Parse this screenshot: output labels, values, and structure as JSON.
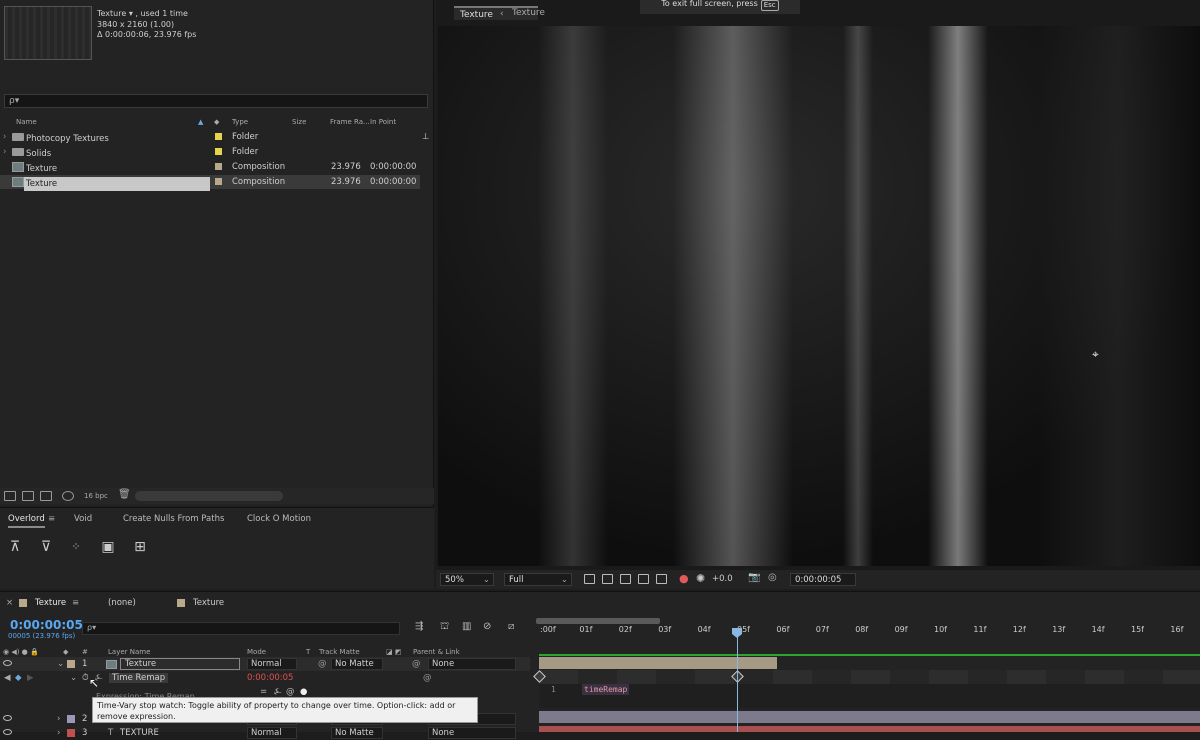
{
  "project": {
    "comp_name": "Texture ▾ , used 1 time",
    "comp_size": "3840 x 2160 (1.00)",
    "comp_duration": "Δ 0:00:00:06, 23.976 fps",
    "search_placeholder": "ρ▾",
    "columns": {
      "name": "Name",
      "type": "Type",
      "size": "Size",
      "frame_rate": "Frame Ra...",
      "in_point": "In Point"
    },
    "rows": [
      {
        "name": "Photocopy Textures",
        "type": "Folder",
        "frame_rate": "",
        "in_point": "",
        "label_color": "#e6d54a"
      },
      {
        "name": "Solids",
        "type": "Folder",
        "frame_rate": "",
        "in_point": "",
        "label_color": "#e6d54a"
      },
      {
        "name": "Texture",
        "type": "Composition",
        "frame_rate": "23.976",
        "in_point": "0:00:00:00",
        "label_color": "#b9a98a"
      },
      {
        "name": "Texture",
        "type": "Composition",
        "frame_rate": "23.976",
        "in_point": "0:00:00:00",
        "label_color": "#b9a98a"
      }
    ],
    "bpc": "16 bpc"
  },
  "overlord": {
    "tabs": [
      "Overlord",
      "Void",
      "Create Nulls From Paths",
      "Clock O Motion"
    ]
  },
  "viewer": {
    "tab_active": "Texture",
    "tab_breadcrumb": "Texture",
    "fullscreen_note": "To exit full screen, press",
    "esc_key": "Esc",
    "zoom": "50%",
    "resolution": "Full",
    "exposure": "+0.0",
    "timecode": "0:00:00:05"
  },
  "timeline": {
    "tab_comp": "Texture",
    "tab_none": "(none)",
    "tab_comp2": "Texture",
    "current_time": "0:00:00:05",
    "frames_label": "00005 (23.976 fps)",
    "search_placeholder": "ρ▾",
    "headers": {
      "num": "#",
      "layer_name": "Layer Name",
      "mode": "Mode",
      "t": "T",
      "track_matte": "Track Matte",
      "parent": "Parent & Link"
    },
    "layers": [
      {
        "num": "1",
        "name": "Texture",
        "mode": "Normal",
        "matte": "No Matte",
        "parent": "None"
      },
      {
        "num": "2",
        "name": "",
        "mode": "Normal",
        "matte": "No Matte",
        "parent": "None"
      },
      {
        "num": "3",
        "name": "TEXTURE",
        "mode": "Normal",
        "matte": "No Matte",
        "parent": "None"
      }
    ],
    "property_name": "Time Remap",
    "property_value": "0:00:00:05",
    "expression_label": "Expression: Time Remap",
    "expression_line": "1",
    "expression_code": "timeRemap",
    "tooltip": "Time-Vary stop watch: Toggle ability of property to change over time. Option-click: add or remove expression.",
    "ruler_ticks": [
      ":00f",
      "01f",
      "02f",
      "03f",
      "04f",
      "05f",
      "06f",
      "07f",
      "08f",
      "09f",
      "10f",
      "11f",
      "12f",
      "13f",
      "14f",
      "15f",
      "16f"
    ],
    "current_frame": 5
  }
}
